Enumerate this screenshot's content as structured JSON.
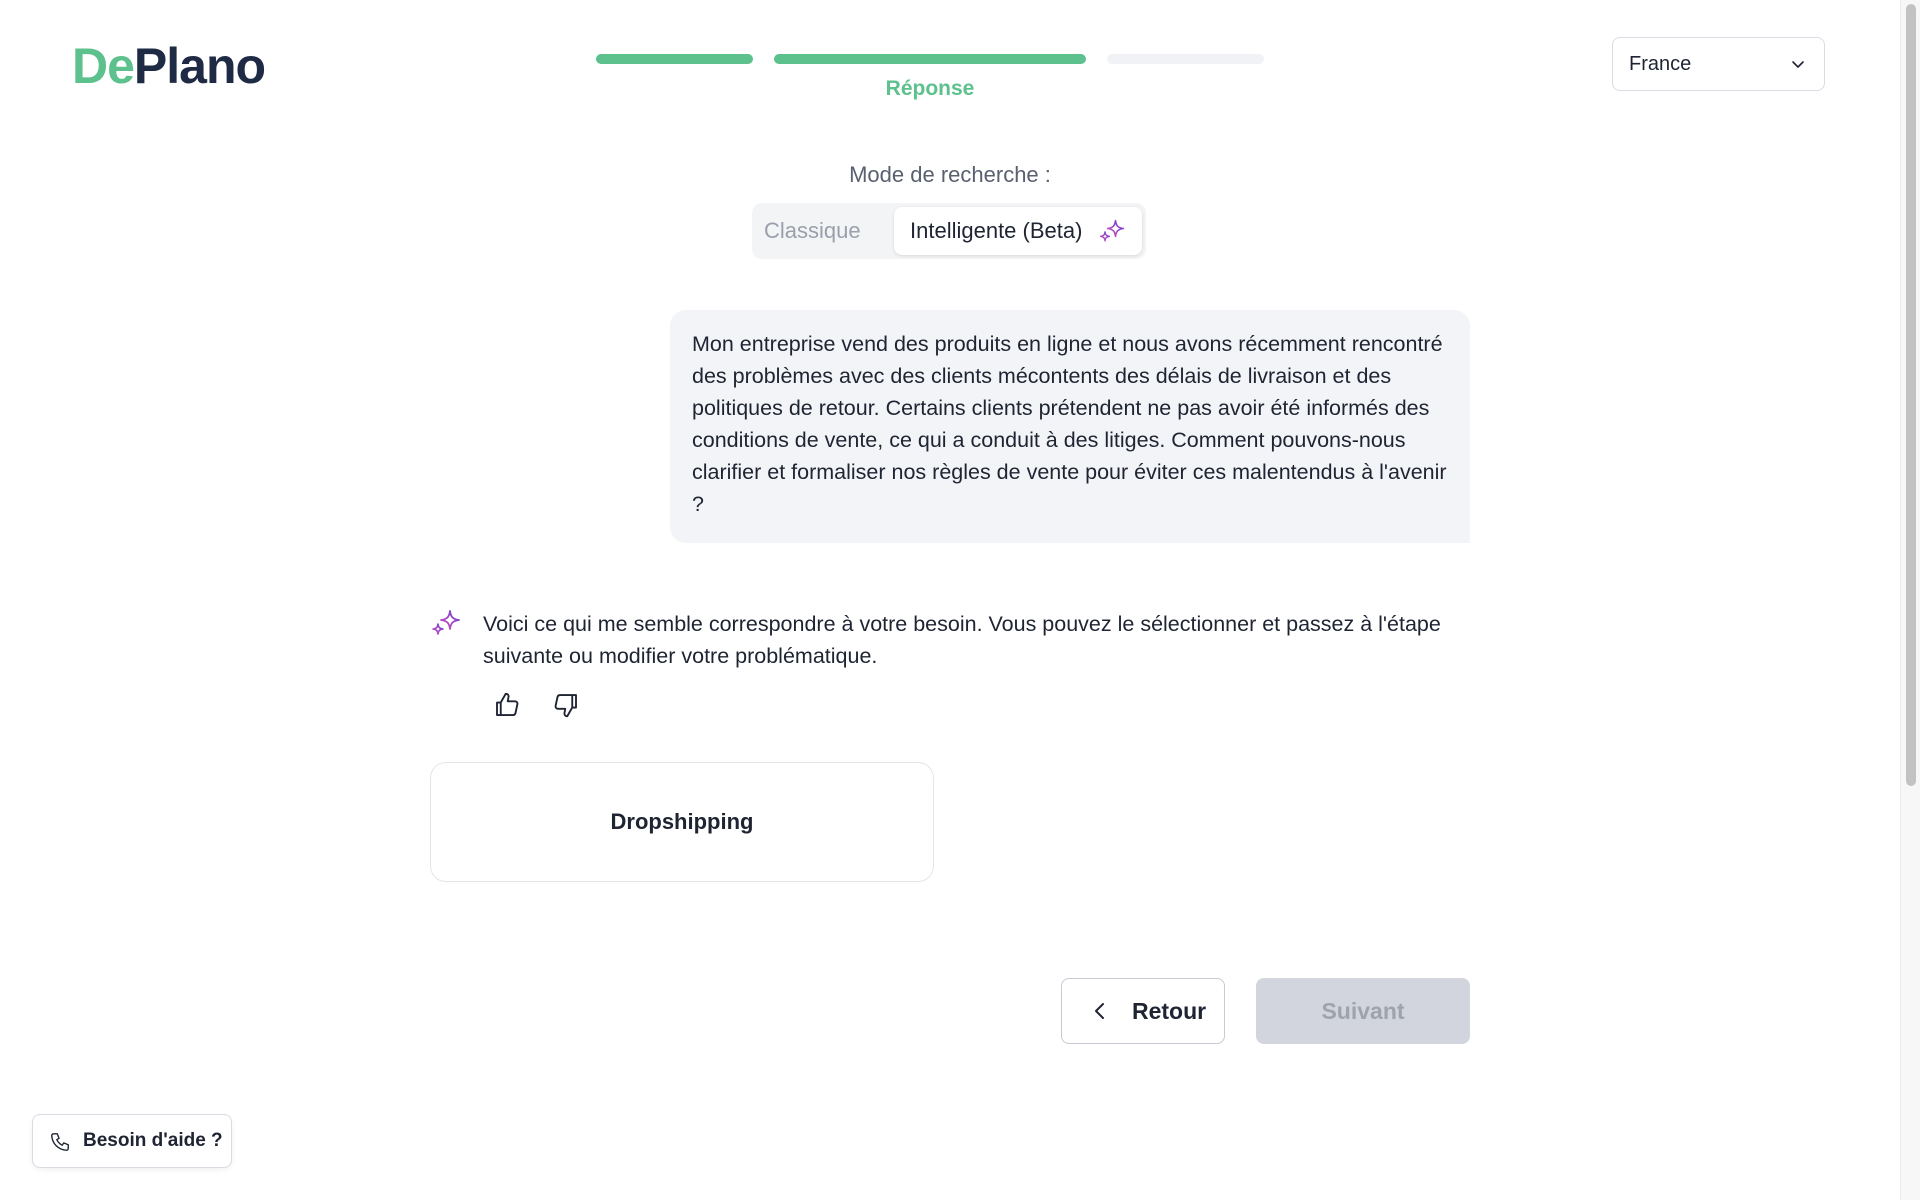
{
  "brand": {
    "logo_part1": "De",
    "logo_part2": "Plano",
    "accent_color": "#5cc18d",
    "navy_color": "#1f2a44"
  },
  "progress": {
    "current_step": 2,
    "total_steps": 3,
    "current_label": "Réponse"
  },
  "country_select": {
    "value": "France",
    "icon": "chevron-down-icon"
  },
  "search_mode": {
    "label": "Mode de recherche :",
    "options": [
      {
        "label": "Classique",
        "selected": false
      },
      {
        "label": "Intelligente (Beta)",
        "selected": true,
        "icon": "sparkle-icon"
      }
    ]
  },
  "user_message": {
    "text": "Mon entreprise vend des produits en ligne et nous avons récemment rencontré des problèmes avec des clients mécontents des délais de livraison et des politiques de retour. Certains clients prétendent ne pas avoir été informés des conditions de vente, ce qui a conduit à des litiges. Comment pouvons-nous clarifier et formaliser nos règles de vente pour éviter ces malentendus à l'avenir ?"
  },
  "assistant_response": {
    "icon": "sparkle-icon",
    "text": "Voici ce qui me semble correspondre à votre besoin. Vous pouvez le sélectionner et passez à l'étape suivante ou modifier votre problématique.",
    "feedback": [
      "thumbs-up-icon",
      "thumbs-down-icon"
    ]
  },
  "suggestions": [
    {
      "label": "Dropshipping"
    }
  ],
  "navigation": {
    "back_label": "Retour",
    "next_label": "Suivant",
    "next_disabled": true
  },
  "help": {
    "label": "Besoin d'aide ?",
    "icon": "phone-icon"
  }
}
